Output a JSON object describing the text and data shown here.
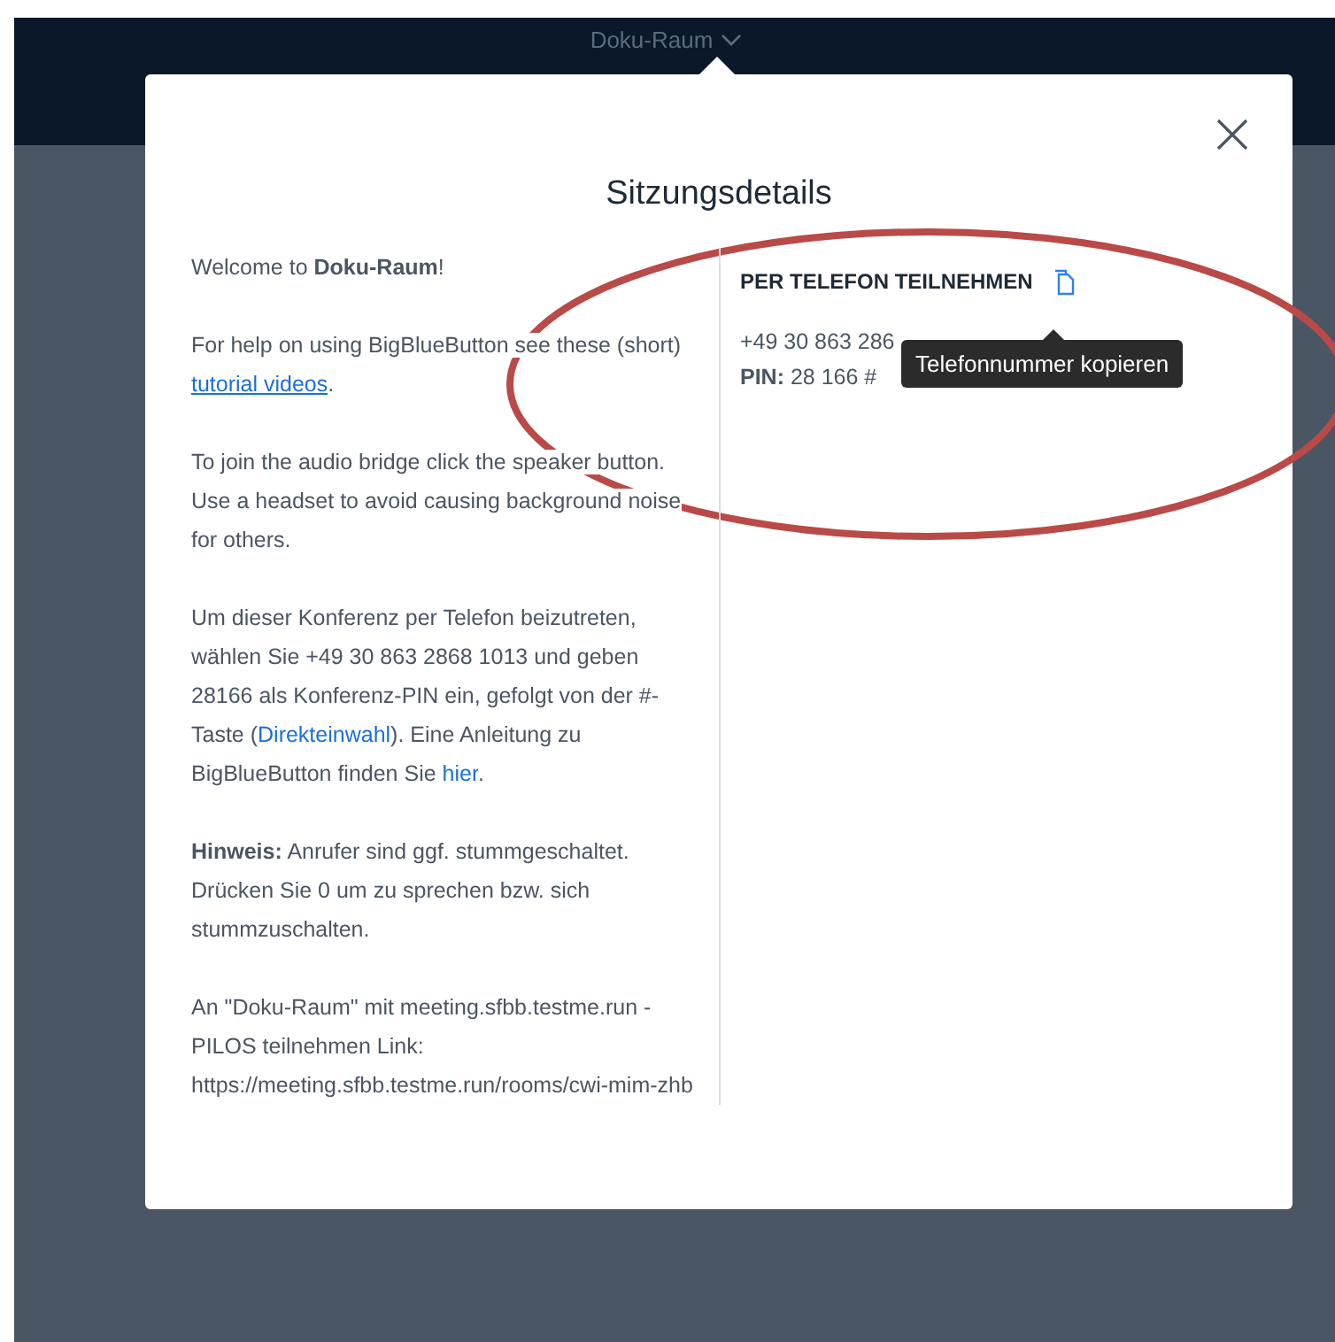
{
  "room_menu": {
    "label": "Doku-Raum"
  },
  "dialog": {
    "title": "Sitzungsdetails",
    "paragraphs": [
      {
        "parts": [
          {
            "kind": "text",
            "text": "Welcome to **Doku-Raum**!"
          }
        ]
      },
      {
        "parts": [
          {
            "kind": "text",
            "text": "For help on using BigBlueButton see these (short) "
          },
          {
            "kind": "link",
            "underlined": true,
            "text": "tutorial videos"
          },
          {
            "kind": "text",
            "text": "."
          }
        ]
      },
      {
        "parts": [
          {
            "kind": "text",
            "text": "To join the audio bridge click the speaker button. Use a headset to avoid causing background noise for others."
          }
        ]
      },
      {
        "parts": [
          {
            "kind": "text",
            "text": "Um dieser Konferenz per Telefon beizutreten, wählen Sie +49 30 863 2868 1013 und geben 28166 als Konferenz-PIN ein, gefolgt von der #-Taste ("
          },
          {
            "kind": "link",
            "underlined": false,
            "text": "Direkteinwahl"
          },
          {
            "kind": "text",
            "text": "). Eine Anleitung zu BigBlueButton finden Sie "
          },
          {
            "kind": "link",
            "underlined": false,
            "text": "hier"
          },
          {
            "kind": "text",
            "text": "."
          }
        ]
      },
      {
        "parts": [
          {
            "kind": "text",
            "text": "**Hinweis:** Anrufer sind ggf. stummgeschaltet. Drücken Sie 0 um zu sprechen bzw. sich stummzuschalten."
          }
        ]
      },
      {
        "parts": [
          {
            "kind": "text",
            "text": "An \"Doku-Raum\" mit meeting.sfbb.testme.run - PILOS teilnehmen Link: https://meeting.sfbb.testme.run/rooms/cwi-mim-zhb"
          }
        ]
      }
    ],
    "phone": {
      "heading": "PER TELEFON TEILNEHMEN",
      "number": "+49 30 863 286",
      "pin": "**PIN:** 28 166 #",
      "tooltip": "Telefonnummer kopieren"
    }
  }
}
